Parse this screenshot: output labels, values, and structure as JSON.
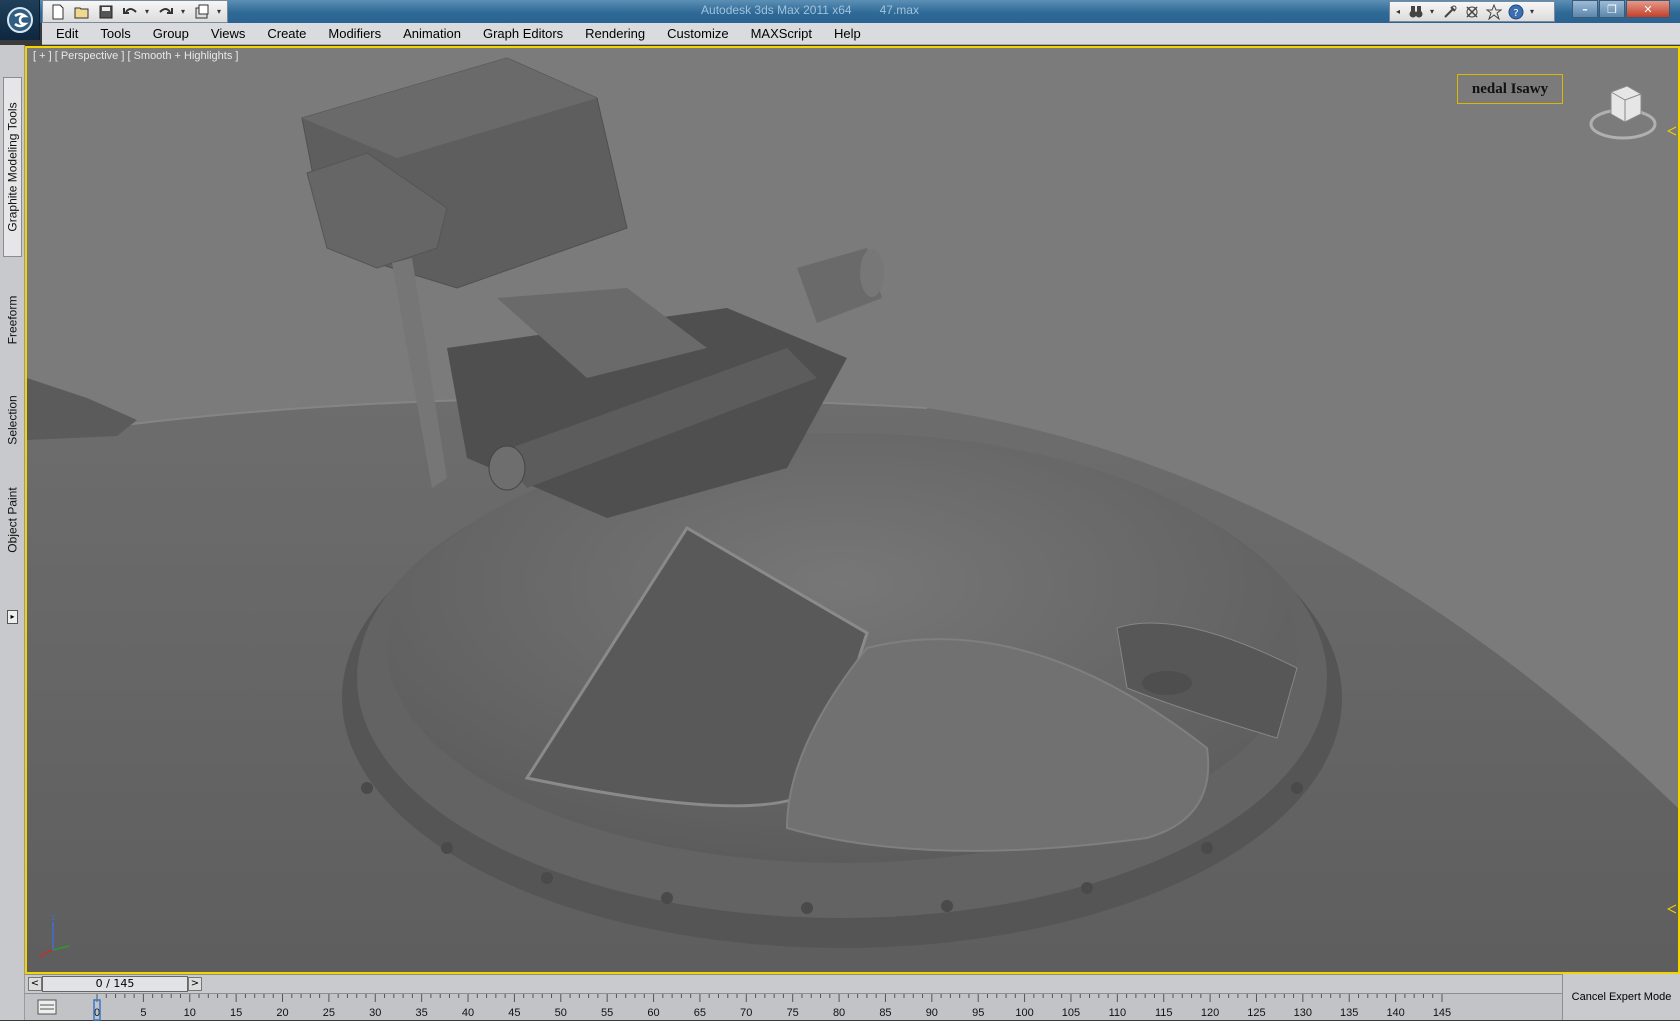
{
  "window": {
    "app_name": "Autodesk 3ds Max  2011 x64",
    "file_name": "47.max"
  },
  "menu": [
    "Edit",
    "Tools",
    "Group",
    "Views",
    "Create",
    "Modifiers",
    "Animation",
    "Graph Editors",
    "Rendering",
    "Customize",
    "MAXScript",
    "Help"
  ],
  "quick_access_icons": [
    "new-file-icon",
    "open-file-icon",
    "save-icon",
    "undo-icon",
    "redo-icon",
    "project-folder-icon"
  ],
  "info_center_icons": [
    "binoculars-icon",
    "communication-icon",
    "favorites-star-icon",
    "help-icon"
  ],
  "ribbon_tabs": [
    "Graphite Modeling Tools",
    "Freeform",
    "Selection",
    "Object Paint"
  ],
  "viewport": {
    "label": "[ + ] [ Perspective ] [ Smooth + Highlights ]",
    "overlay_text": "nedal Isawy",
    "border_color": "#f2d400",
    "background_color": "#7b7b7b"
  },
  "time_slider": {
    "position": "0 / 145",
    "current_frame": 0,
    "total_frames": 145,
    "prev_label": "<",
    "next_label": ">"
  },
  "trackbar": {
    "ticks": [
      0,
      5,
      10,
      15,
      20,
      25,
      30,
      35,
      40,
      45,
      50,
      55,
      60,
      65,
      70,
      75,
      80,
      85,
      90,
      95,
      100,
      105,
      110,
      115,
      120,
      125,
      130,
      135,
      140,
      145
    ]
  },
  "expert_mode": {
    "cancel_label": "Cancel Expert Mode"
  }
}
